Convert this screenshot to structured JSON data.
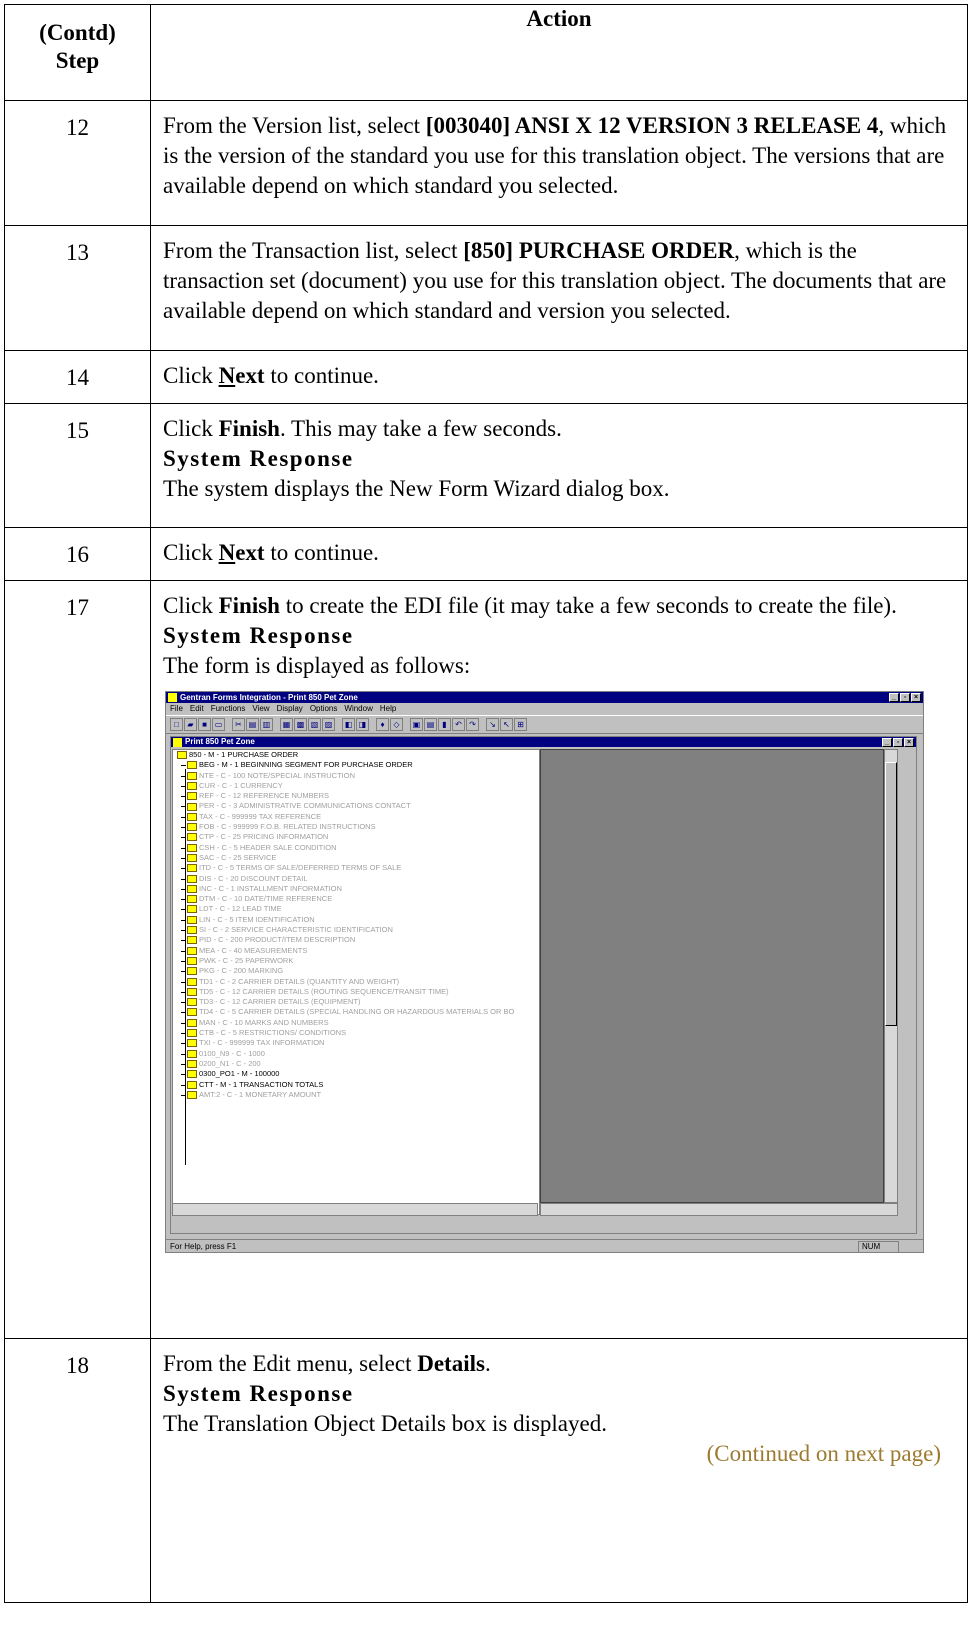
{
  "header": {
    "step": "(Contd) Step",
    "step_line1": "(Contd)",
    "step_line2": "Step",
    "action": "Action"
  },
  "rows": [
    {
      "num": "12",
      "p1": "From the Version list, select ",
      "b1": "[003040] ANSI X 12 VERSION 3 RELEASE 4",
      "p2": ", which is the version of the standard you use for this translation object. The versions that are available depend on which standard you selected."
    },
    {
      "num": "13",
      "p1": "From the Transaction list, select ",
      "b1": "[850] PURCHASE ORDER",
      "p2": ", which is the transaction set (document) you use for this translation object. The documents that are available depend on which standard and version you selected."
    },
    {
      "num": "14",
      "p1": "Click ",
      "b_u": "N",
      "b_rest": "ext",
      "p2": " to continue."
    },
    {
      "num": "15",
      "p1": "Click ",
      "b1": "Finish",
      "p2": ". This may take a few seconds.",
      "sr_head": "System Response",
      "sr_text": "The system displays the New Form Wizard dialog box."
    },
    {
      "num": "16",
      "p1": "Click ",
      "b_u": "N",
      "b_rest": "ext",
      "p2": " to continue."
    },
    {
      "num": "17",
      "p1": "Click ",
      "b1": "Finish",
      "p2": " to create the EDI file (it may take a few seconds to create the file).",
      "sr_head": "System Response",
      "sr_text": "The form is displayed as follows:"
    },
    {
      "num": "18",
      "p1": "From the Edit menu, select ",
      "b1": "Details",
      "p2": ".",
      "sr_head": "System Response",
      "sr_text": "The Translation Object Details box is displayed.",
      "continued": "(Continued on next page)"
    }
  ],
  "screenshot": {
    "app_title": "Gentran Forms Integration - Print 850 Pet Zone",
    "menus": [
      "File",
      "Edit",
      "Functions",
      "View",
      "Display",
      "Options",
      "Window",
      "Help"
    ],
    "child_title": "Print 850 Pet Zone",
    "tree_root": "850 - M - 1 PURCHASE ORDER",
    "tree_items": [
      "BEG - M - 1 BEGINNING SEGMENT FOR PURCHASE ORDER",
      "NTE - C - 100 NOTE/SPECIAL INSTRUCTION",
      "CUR - C - 1 CURRENCY",
      "REF - C - 12 REFERENCE NUMBERS",
      "PER - C - 3 ADMINISTRATIVE COMMUNICATIONS CONTACT",
      "TAX - C - 999999 TAX REFERENCE",
      "FOB - C - 999999 F.O.B. RELATED INSTRUCTIONS",
      "CTP - C - 25 PRICING INFORMATION",
      "CSH - C - 5 HEADER SALE CONDITION",
      "SAC - C - 25 SERVICE",
      "ITD - C - 5 TERMS OF SALE/DEFERRED TERMS OF SALE",
      "DIS - C - 20 DISCOUNT DETAIL",
      "INC - C - 1 INSTALLMENT INFORMATION",
      "DTM - C - 10 DATE/TIME REFERENCE",
      "LDT - C - 12 LEAD TIME",
      "LIN - C - 5 ITEM IDENTIFICATION",
      "SI - C - 2 SERVICE CHARACTERISTIC IDENTIFICATION",
      "PID - C - 200 PRODUCT/ITEM DESCRIPTION",
      "MEA - C - 40 MEASUREMENTS",
      "PWK - C - 25 PAPERWORK",
      "PKG - C - 200 MARKING",
      "TD1 - C - 2 CARRIER DETAILS (QUANTITY AND WEIGHT)",
      "TD5 - C - 12 CARRIER DETAILS (ROUTING SEQUENCE/TRANSIT TIME)",
      "TD3 - C - 12 CARRIER DETAILS (EQUIPMENT)",
      "TD4 - C - 5 CARRIER DETAILS (SPECIAL HANDLING OR HAZARDOUS MATERIALS OR BO",
      "MAN - C - 10 MARKS AND NUMBERS",
      "CTB - C - 5 RESTRICTIONS/ CONDITIONS",
      "TXI - C - 999999 TAX INFORMATION",
      "0100_N9 - C - 1000",
      "0200_N1 - C - 200",
      "0300_PO1 - M - 100000",
      "CTT - M - 1 TRANSACTION TOTALS",
      "AMT:2 - C - 1 MONETARY AMOUNT"
    ],
    "dark_items": [
      0,
      30,
      31
    ],
    "status_text": "For Help, press F1",
    "status_num": "NUM"
  }
}
